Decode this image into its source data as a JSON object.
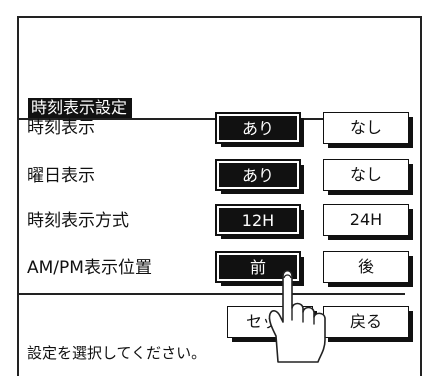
{
  "screen": {
    "title": "時刻表示設定",
    "status_text": "設定を選択してください。"
  },
  "rows": [
    {
      "label": "時刻表示",
      "options": [
        "あり",
        "なし"
      ],
      "selected": 0
    },
    {
      "label": "曜日表示",
      "options": [
        "あり",
        "なし"
      ],
      "selected": 0
    },
    {
      "label": "時刻表示方式",
      "options": [
        "12H",
        "24H"
      ],
      "selected": 0
    },
    {
      "label": "AM/PM表示位置",
      "options": [
        "前",
        "後"
      ],
      "selected": 0
    }
  ],
  "footer": {
    "set_label": "セット",
    "back_label": "戻る"
  },
  "icons": {
    "pointer": "pointing-hand-icon"
  }
}
